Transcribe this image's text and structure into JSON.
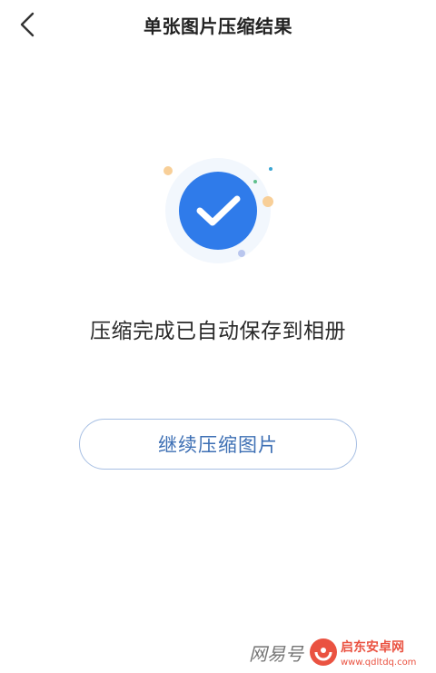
{
  "header": {
    "title": "单张图片压缩结果",
    "back_icon": "chevron-left-icon"
  },
  "result": {
    "icon": "check-circle-icon",
    "accent_color": "#2f7bea",
    "message": "压缩完成已自动保存到相册"
  },
  "actions": {
    "continue_label": "继续压缩图片"
  },
  "watermark": {
    "left_text": "网易号",
    "brand_name": "启东安卓网",
    "brand_url": "www.qdltdq.com"
  }
}
